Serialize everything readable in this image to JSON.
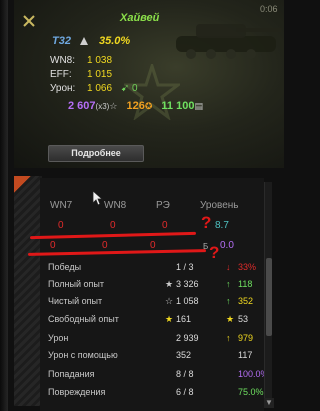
{
  "card": {
    "time": "0:06",
    "player_name": "Хайвей",
    "tank_name": "Т32",
    "tank_percent": "35.0%",
    "wn8_label": "WN8:",
    "wn8_value": "1 038",
    "eff_label": "EFF:",
    "eff_value": "1 015",
    "dmg_label": "Урон:",
    "dmg_value": "1 066",
    "dmg_extra": "0",
    "battles": "2 607",
    "battles_mult": "(x3)",
    "medals": "126",
    "credits": "11 100",
    "details_button": "Подробнее"
  },
  "table": {
    "headers": [
      "WN7",
      "WN8",
      "РЭ",
      "Уровень"
    ],
    "row1": {
      "zeros": [
        "0",
        "0",
        "0"
      ],
      "level": "8.7"
    },
    "row2": {
      "zeros": [
        "0",
        "0",
        "0"
      ],
      "prefix": "Б",
      "level": "0.0"
    },
    "stats": [
      {
        "label": "Победы",
        "value": "1 / 3",
        "diff": "33%",
        "diff_color": "#e02b2b",
        "arrow": "↓"
      },
      {
        "label": "Полный опыт",
        "value": "3 326",
        "diff": "118",
        "diff_color": "#6fe060",
        "arrow": "↑"
      },
      {
        "label": "Чистый опыт",
        "value": "1 058",
        "diff": "352",
        "diff_color": "#f0d820",
        "arrow": "↑"
      },
      {
        "label": "Свободный опыт",
        "value": "161",
        "diff": "53",
        "diff_color": "#dcdcdc",
        "arrow": "★"
      },
      {
        "label": "Урон",
        "value": "2 939",
        "diff": "979",
        "diff_color": "#f0d820",
        "arrow": "↑"
      },
      {
        "label": "Урон с помощью",
        "value": "352",
        "diff": "117",
        "diff_color": "#dcdcdc",
        "arrow": ""
      },
      {
        "label": "Попадания",
        "value": "8 / 8",
        "diff": "100.0%",
        "diff_color": "#b46ef5",
        "arrow": ""
      },
      {
        "label": "Повреждения",
        "value": "6 / 8",
        "diff": "75.0%",
        "diff_color": "#6fe060",
        "arrow": ""
      }
    ]
  },
  "annotation": {
    "qmark": "?"
  },
  "colors": {
    "accent_red": "#e01818",
    "name_green": "#8be04a",
    "yellow": "#f0d820",
    "purple": "#b46ef5"
  }
}
